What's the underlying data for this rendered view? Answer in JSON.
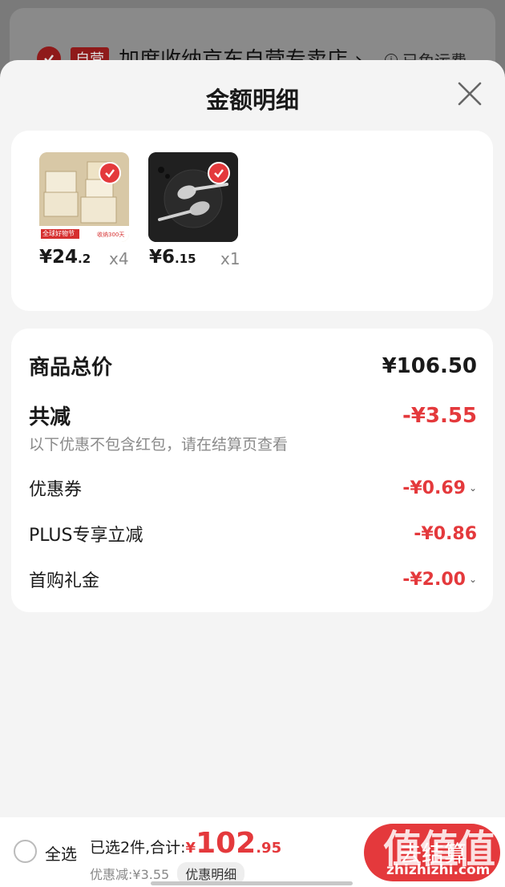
{
  "background": {
    "self_badge": "自营",
    "store_name": "加度收纳京东自营专卖店",
    "store_chevron": "›",
    "shipping": "已免运费",
    "info_icon": "i"
  },
  "sheet": {
    "title": "金额明细",
    "close_icon": "close-icon"
  },
  "products": [
    {
      "name": "storage-box",
      "price_int": "¥24",
      "price_dec": ".2",
      "qty": "x4",
      "thumb_label": "全球好物节",
      "thumb_badge": "收纳300天"
    },
    {
      "name": "spoon-set",
      "price_int": "¥6",
      "price_dec": ".15",
      "qty": "x1"
    }
  ],
  "summary": {
    "total_label": "商品总价",
    "total_value": "¥106.50",
    "discount_label": "共减",
    "discount_value": "-¥3.55",
    "note": "以下优惠不包含红包，请在结算页查看",
    "items": [
      {
        "label": "优惠券",
        "value": "-¥0.69",
        "chevron": true
      },
      {
        "label": "PLUS专享立减",
        "value": "-¥0.86",
        "chevron": false
      },
      {
        "label": "首购礼金",
        "value": "-¥2.00",
        "chevron": true
      }
    ]
  },
  "bottom_bar": {
    "select_all": "全选",
    "selected_text": "已选2件,合计:",
    "currency": "¥",
    "total_int": "102",
    "total_dec": ".95",
    "discount_text": "优惠减:¥3.55",
    "detail_button": "优惠明细",
    "checkout": "去结算"
  },
  "watermark": {
    "text": "值值值",
    "url": "zhizhizhi.com"
  },
  "colors": {
    "accent": "#e4393c",
    "sheet_bg": "#f4f4f4",
    "card_bg": "#ffffff",
    "muted": "#8a8a8a"
  }
}
